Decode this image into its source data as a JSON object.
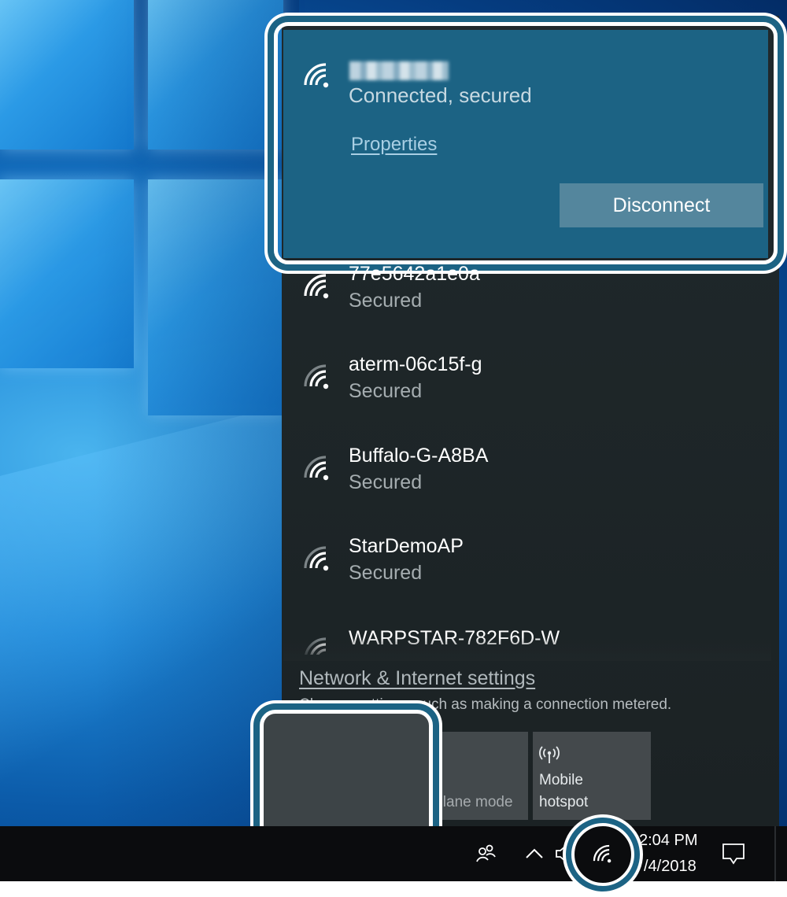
{
  "connected_network": {
    "ssid": "",
    "status": "Connected, secured",
    "properties_label": "Properties",
    "disconnect_label": "Disconnect"
  },
  "networks": [
    {
      "name": "77e5642a1e0a",
      "status": "Secured"
    },
    {
      "name": "aterm-06c15f-g",
      "status": "Secured"
    },
    {
      "name": "Buffalo-G-A8BA",
      "status": "Secured"
    },
    {
      "name": "StarDemoAP",
      "status": "Secured"
    },
    {
      "name": "WARPSTAR-782F6D-W",
      "status": ""
    }
  ],
  "settings": {
    "link_label": "Network & Internet settings",
    "description": "Change settings, such as making a connection metered."
  },
  "quick_actions": {
    "wifi_label": "",
    "airplane_label": "Airplane mode",
    "hotspot_label_line1": "Mobile",
    "hotspot_label_line2": "hotspot"
  },
  "taskbar": {
    "time": "2:04 PM",
    "date": "/4/2018"
  },
  "icons": {
    "wifi": "wifi-icon",
    "people": "people-icon",
    "chevron": "chevron-up-icon",
    "volume": "volume-icon",
    "action_center": "action-center-icon",
    "hotspot": "hotspot-icon",
    "airplane": "airplane-icon"
  },
  "colors": {
    "flyout_bg": "#1f2628",
    "connected_card": "#1c6384",
    "accent_tile": "#2b90c6",
    "highlight_ring": "#1c6384"
  }
}
